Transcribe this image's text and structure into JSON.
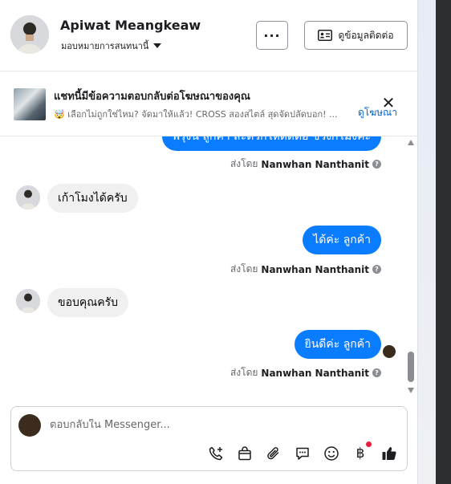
{
  "header": {
    "name": "Apiwat Meangkeaw",
    "assignment": "มอบหมายการสนทนานี้",
    "more_label": "···",
    "contact_label": "ดูข้อมูลติดต่อ"
  },
  "ad": {
    "title": "แชทนี้มีข้อความตอบกลับต่อโฆษณาของคุณ",
    "snippet": "🤯 เลือกไม่ถูกใช่ไหม? จัดมาให้แล้ว! CROSS สองสไตล์ สุดจัดปลัดบอก! ...",
    "link": "ดูโฆษณา",
    "close": "✕"
  },
  "messages": [
    {
      "text": "พรุ่งนี้ ลูกค้า สะดวกให้ติดต่อ ช่วงกี่โมงคะ",
      "from": "page"
    },
    {
      "sender_prefix": "ส่งโดย",
      "sender_name": "Nanwhan Nanthanit"
    },
    {
      "text": "เก้าโมงได้ครับ",
      "from": "customer"
    },
    {
      "text": "ได้ค่ะ ลูกค้า",
      "from": "page"
    },
    {
      "sender_prefix": "ส่งโดย",
      "sender_name": "Nanwhan Nanthanit"
    },
    {
      "text": "ขอบคุณครับ",
      "from": "customer"
    },
    {
      "text": "ยินดีค่ะ ลูกค้า",
      "from": "page"
    },
    {
      "sender_prefix": "ส่งโดย",
      "sender_name": "Nanwhan Nanthanit"
    }
  ],
  "composer": {
    "placeholder": "ตอบกลับใน Messenger...",
    "tools": [
      "call-add-icon",
      "shopping-bag-icon",
      "paperclip-icon",
      "saved-reply-icon",
      "emoji-icon",
      "baht-payment-icon",
      "like-icon"
    ],
    "baht_symbol": "฿"
  },
  "colors": {
    "outgoing_bubble": "#0a7cff",
    "incoming_bubble": "#f0f0f0",
    "link": "#0064d1"
  }
}
